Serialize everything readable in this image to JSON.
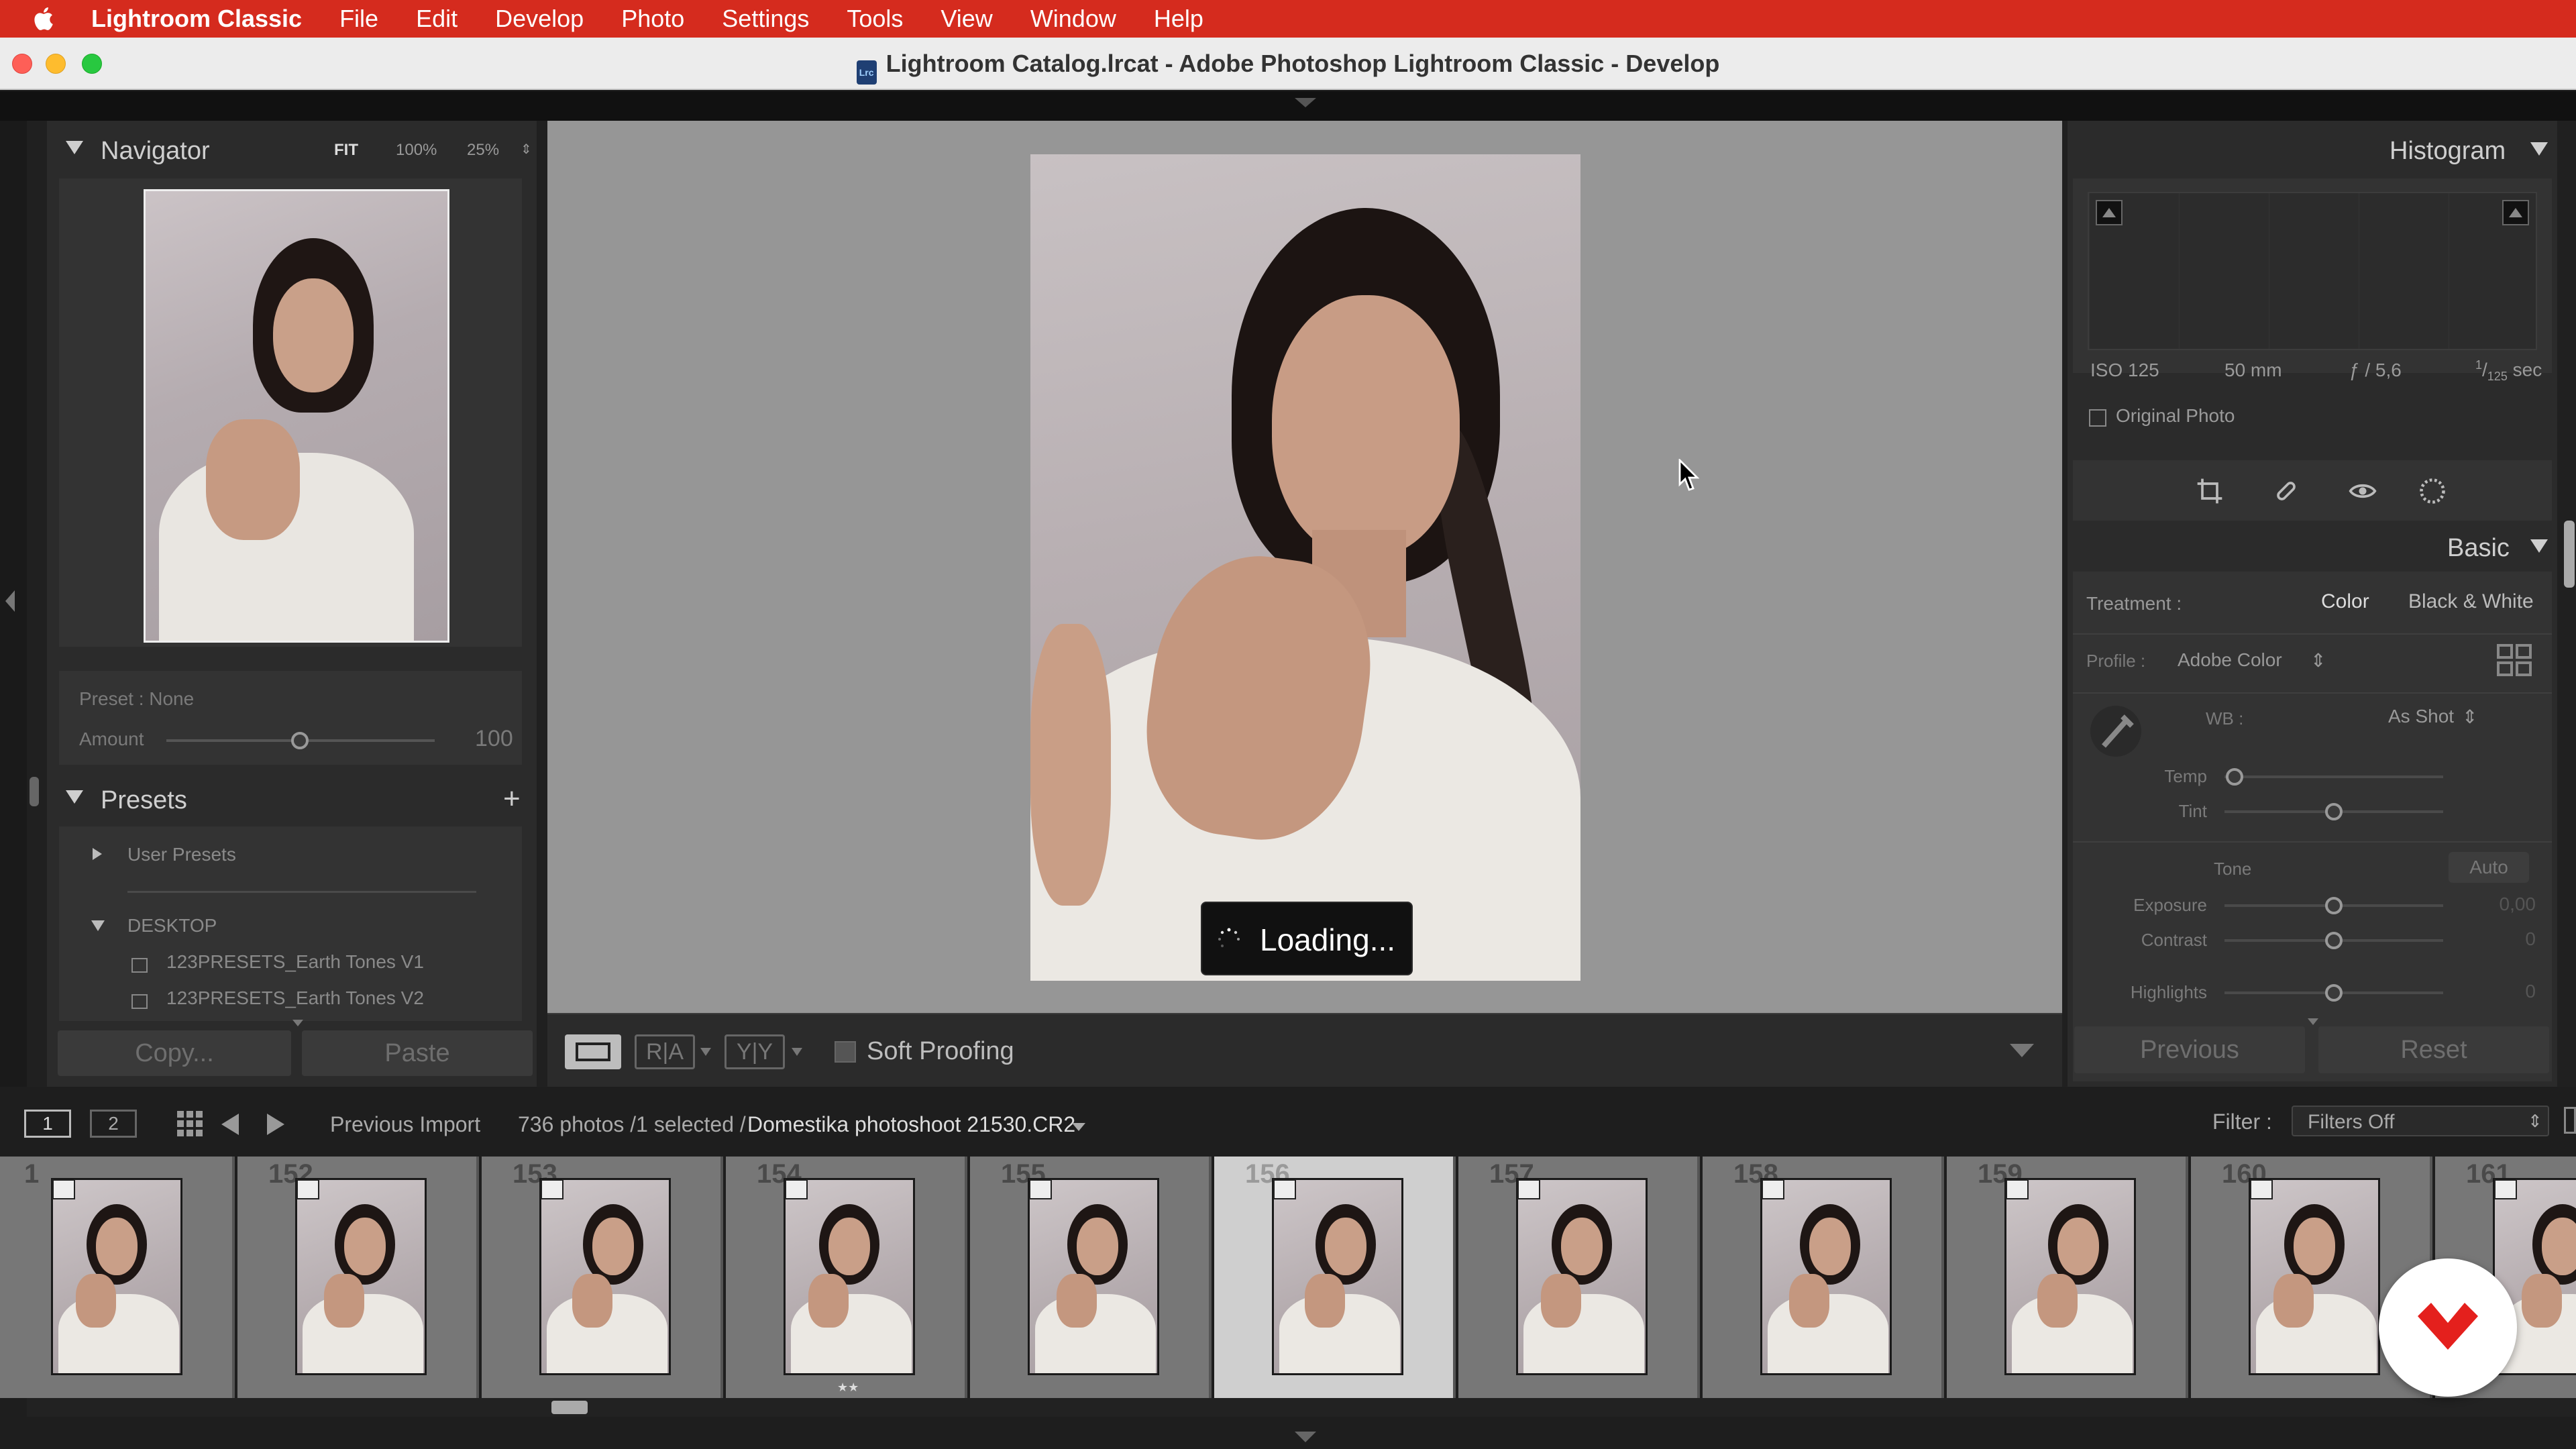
{
  "menubar": {
    "app_name": "Lightroom Classic",
    "items": [
      "File",
      "Edit",
      "Develop",
      "Photo",
      "Settings",
      "Tools",
      "View",
      "Window",
      "Help"
    ]
  },
  "window": {
    "title": "Lightroom Catalog.lrcat - Adobe Photoshop Lightroom Classic - Develop"
  },
  "navigator": {
    "title": "Navigator",
    "zoom_fit": "FIT",
    "zoom_100": "100%",
    "zoom_25": "25%",
    "preset_label": "Preset : None",
    "amount_label": "Amount",
    "amount_value": "100"
  },
  "presets": {
    "title": "Presets",
    "add_icon": "+",
    "groups": [
      "User Presets",
      "DESKTOP"
    ],
    "items": [
      "123PRESETS_Earth Tones V1",
      "123PRESETS_Earth Tones V2"
    ]
  },
  "left_buttons": {
    "copy": "Copy...",
    "paste": "Paste"
  },
  "main": {
    "loading_text": "Loading...",
    "soft_proofing": "Soft Proofing"
  },
  "histogram": {
    "title": "Histogram",
    "iso": "ISO 125",
    "focal": "50 mm",
    "aperture": "ƒ / 5,6",
    "shutter_num": "1",
    "shutter_den": "125",
    "shutter_unit": "sec",
    "original_photo": "Original Photo"
  },
  "basic": {
    "title": "Basic",
    "treatment_label": "Treatment :",
    "treatment_color": "Color",
    "treatment_bw": "Black & White",
    "profile_label": "Profile :",
    "profile_value": "Adobe Color",
    "wb_label": "WB :",
    "wb_value": "As Shot",
    "temp_label": "Temp",
    "tint_label": "Tint",
    "tone_label": "Tone",
    "auto_label": "Auto",
    "exposure_label": "Exposure",
    "exposure_value": "0,00",
    "contrast_label": "Contrast",
    "contrast_value": "0",
    "highlights_label": "Highlights",
    "highlights_value": "0"
  },
  "right_buttons": {
    "previous": "Previous",
    "reset": "Reset"
  },
  "filmbar": {
    "screen1": "1",
    "screen2": "2",
    "source": "Previous Import",
    "count": "736 photos /1 selected /",
    "filename": "Domestika photoshoot 21530.CR2",
    "filter_label": "Filter :",
    "filter_value": "Filters Off"
  },
  "filmstrip": {
    "numbers": [
      "1",
      "152",
      "153",
      "154",
      "155",
      "156",
      "157",
      "158",
      "159",
      "160",
      "161"
    ],
    "selected_index": 5,
    "stars_154": "★★"
  },
  "colors": {
    "menubar": "#d52b1e",
    "canvas_bg": "#969696",
    "panel_bg": "#2b2b2b",
    "logo": "#e4201d"
  }
}
